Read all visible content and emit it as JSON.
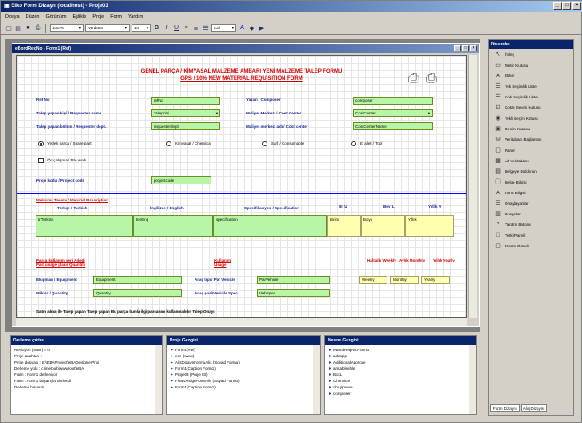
{
  "window": {
    "title": "Elko Form Dizayn (localhost) - Proje03"
  },
  "menu": [
    "Dosya",
    "Düzen",
    "Görünüm",
    "Eşlikle",
    "Proje",
    "Form",
    "Yardım"
  ],
  "toolbar": {
    "zoom": "100 %",
    "font": "Verdana",
    "size": "10",
    "color": "#0000ff"
  },
  "child": {
    "title": "eBordReqNo - Form1 (Ref)"
  },
  "form": {
    "title_line1": "GENEL PARÇA / KİMYASAL MALZEME AMBARI YENİ MALZEME TALEP FORMU",
    "title_line2": "GPS / 10% NEW MATERIAL REQUISITION FORM",
    "labels": {
      "ref": "Ref No",
      "requester": "Talep yapan kişi / Requester name",
      "dept": "Talep yapan bölüm / Requester dept.",
      "composer": "Yazan / Composer",
      "costcenter": "Maliyet Merkezi / Cost Center",
      "costtext": "Maliyet merkezi adı / Cost center",
      "spare": "Yedek parça / Spare part",
      "chem": "Kimyasal / Chemical",
      "consumable": "Sarf / Consumable",
      "tool": "El aleti / Tool",
      "prework": "Ön çalışma / Pre work",
      "project": "Proje kodu / Project code",
      "desc": "Malzeme Tanımı / Material Description",
      "turkish": "Türkçe / Turkish",
      "english": "İngilizce / English",
      "spec": "Spesifikasyon / Specification",
      "unit": "Br U",
      "size": "Boy L",
      "year": "Yıllık Y",
      "parts": "Parça kullanım yeri Adedi",
      "partsEn": "Part usage place Quantity",
      "equipment": "Ekipman / Equipment",
      "vehicle": "Araç tipi / Par Vehicle",
      "quantity": "Miktar / Quantity",
      "vehicleSpec": "Araç şasi/Vehicle Spec.",
      "qty": "Kullanım",
      "qtyEn": "Usage",
      "weekly": "Haftalık Weekly",
      "monthly": "Aylık Monthly",
      "yearly": "Yıllık Yearly",
      "footer": "Satın alma ile     Talep yapan     Talep yapan     Bu parça bunla ilgi parçasını kullanmalıdır     Talep Onayı"
    },
    "values": {
      "ref": "refNo",
      "requester": "Talepcisi",
      "dept": "requesterdept",
      "composer": "composer",
      "costcenter": "CostCenter",
      "costtext": "CostCenterName",
      "project": "projectcode",
      "turkish": "trTurkish",
      "english": "tenEng",
      "spec": "specification",
      "unit": "Birim",
      "size": "Boyu",
      "year": "Yıllık",
      "equipment": "Equipment",
      "vehicle": "ParVehicle",
      "quantity": "Quantity",
      "vehicleSpec": "VehSpec",
      "weekly": "Weekly",
      "monthly": "Monthly",
      "yearly": "Yearly"
    }
  },
  "toolbox": {
    "title": "Nesneler",
    "items": [
      {
        "label": "İmleç",
        "icon": "pointer-icon"
      },
      {
        "label": "Metin Kutusu",
        "icon": "textbox-icon"
      },
      {
        "label": "Etiket",
        "icon": "label-icon"
      },
      {
        "label": "Tek Seçimlik Liste",
        "icon": "list-icon"
      },
      {
        "label": "Çok Seçimlik Liste",
        "icon": "multi-list-icon"
      },
      {
        "label": "Çoklu Seçim Kutusu",
        "icon": "checkbox-icon"
      },
      {
        "label": "Tekli Seçim Kutusu",
        "icon": "radio-icon"
      },
      {
        "label": "Resim Kutusu",
        "icon": "image-icon"
      },
      {
        "label": "Veritabanı Bağlantısı",
        "icon": "database-icon"
      },
      {
        "label": "Panel",
        "icon": "panel-icon"
      },
      {
        "label": "Ait Veritabanı",
        "icon": "grid-icon"
      },
      {
        "label": "Belgeye Doldurun",
        "icon": "document-icon"
      },
      {
        "label": "Belge Bilgisi",
        "icon": "info-icon"
      },
      {
        "label": "Form Bilgisi",
        "icon": "form-icon"
      },
      {
        "label": "Onaylayanlar",
        "icon": "approve-icon"
      },
      {
        "label": "Dosyalar",
        "icon": "files-icon"
      },
      {
        "label": "Yardım Butonu",
        "icon": "help-icon"
      },
      {
        "label": "Yetki Paneli",
        "icon": "auth-icon"
      },
      {
        "label": "Frame Paneli",
        "icon": "frame-icon"
      }
    ],
    "tabs": [
      "Form Dizaynı",
      "Alış Dizaynı"
    ]
  },
  "panes": {
    "output": {
      "title": "Derleme çıktısı",
      "lines": [
        "Revizyon (Satır) = 0",
        "Proje anahtarı :",
        "Proje dosyası : E:\\EBAProject\\eBADesignerProj",
        "Derleme yolu : c:\\inetpub\\wwwroot\\eBA",
        "Form : Form1 derleniyor",
        "Form : Form1 başarıyla derlendi",
        "Derleme başarılı"
      ]
    },
    "project": {
      "title": "Proje Gezgini",
      "lines": [
        "Form1(Ref)",
        "eee (www)",
        "AltsDizaynFormuAliş (Soyad Formu)",
        "Form1(Caption Form1)",
        "Proje03 (Proje 03)",
        "FlowDesignFormAliş (Soyad Formu)",
        "Form1(Caption Form1)"
      ]
    },
    "objects": {
      "title": "Nesne Gezgini",
      "lines": [
        "eBordReqNo.Form1",
        "addapp",
        "AdditionalApprove",
        "amtableeble",
        "BoxL",
        "Chemical",
        "cbApprove",
        "composer"
      ]
    }
  }
}
